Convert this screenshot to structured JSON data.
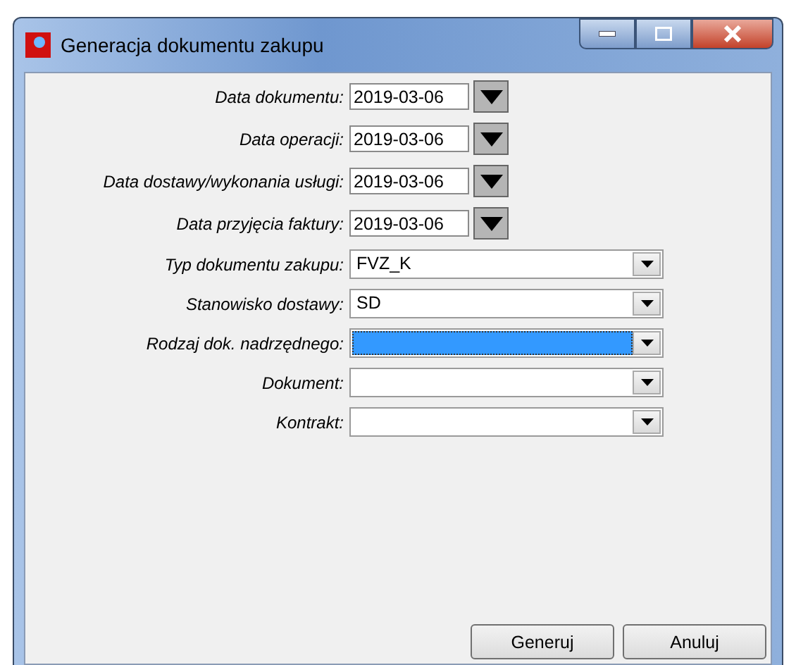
{
  "window": {
    "title": "Generacja dokumentu zakupu"
  },
  "fields": [
    {
      "kind": "date",
      "label": "Data dokumentu:",
      "value": "2019-03-06"
    },
    {
      "kind": "date",
      "label": "Data operacji:",
      "value": "2019-03-06"
    },
    {
      "kind": "date",
      "label": "Data dostawy/wykonania usługi:",
      "value": "2019-03-06"
    },
    {
      "kind": "date",
      "label": "Data przyjęcia faktury:",
      "value": "2019-03-06"
    },
    {
      "kind": "combo",
      "label": "Typ dokumentu zakupu:",
      "value": "FVZ_K",
      "focused": false
    },
    {
      "kind": "combo",
      "label": "Stanowisko dostawy:",
      "value": "SD",
      "focused": false
    },
    {
      "kind": "combo",
      "label": "Rodzaj dok. nadrzędnego:",
      "focused": true
    },
    {
      "kind": "combo",
      "label": "Dokument:",
      "focused": false
    },
    {
      "kind": "combo",
      "label": "Kontrakt:",
      "focused": false
    }
  ],
  "buttons": [
    "Generuj",
    "Anuluj"
  ]
}
